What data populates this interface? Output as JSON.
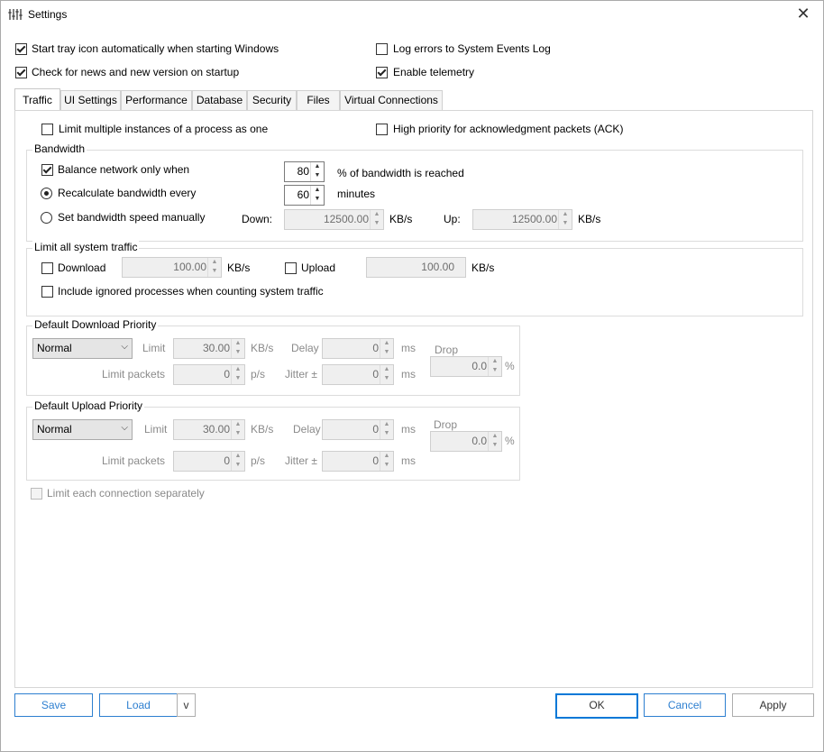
{
  "window": {
    "title": "Settings",
    "app_icon": "settings-app-icon",
    "close_glyph": "✕"
  },
  "global_options": {
    "start_tray": {
      "label": "Start tray icon automatically when starting Windows",
      "checked": true
    },
    "check_news": {
      "label": "Check for news and new version on startup",
      "checked": true
    },
    "log_errors": {
      "label": "Log errors to System Events Log",
      "checked": false
    },
    "telemetry": {
      "label": "Enable telemetry",
      "checked": true
    }
  },
  "tabs": [
    {
      "label": "Traffic",
      "active": true
    },
    {
      "label": "UI Settings",
      "active": false
    },
    {
      "label": "Performance",
      "active": false
    },
    {
      "label": "Database",
      "active": false
    },
    {
      "label": "Security",
      "active": false
    },
    {
      "label": "Files",
      "active": false
    },
    {
      "label": "Virtual Connections",
      "active": false
    }
  ],
  "traffic": {
    "limit_instances": {
      "label": "Limit multiple instances of a process as one",
      "checked": false
    },
    "high_priority_ack": {
      "label": "High priority for acknowledgment packets (ACK)",
      "checked": false
    },
    "bandwidth": {
      "title": "Bandwidth",
      "balance": {
        "label": "Balance network only when",
        "checked": true,
        "value": "80",
        "suffix": "% of bandwidth is reached"
      },
      "recalculate": {
        "label": "Recalculate bandwidth every",
        "selected": true,
        "value": "60",
        "suffix": "minutes"
      },
      "manual": {
        "label": "Set bandwidth speed manually",
        "selected": false
      },
      "down_label": "Down:",
      "down_value": "12500.00",
      "down_unit": "KB/s",
      "up_label": "Up:",
      "up_value": "12500.00",
      "up_unit": "KB/s"
    },
    "system_traffic": {
      "title": "Limit all system traffic",
      "download": {
        "label": "Download",
        "checked": false,
        "value": "100.00",
        "unit": "KB/s"
      },
      "upload": {
        "label": "Upload",
        "checked": false,
        "value": "100.00",
        "unit": "KB/s"
      },
      "include_ignored": {
        "label": "Include ignored processes when counting system traffic",
        "checked": false
      }
    },
    "download_priority": {
      "title": "Default Download Priority",
      "priority": "Normal",
      "limit_label": "Limit",
      "limit_value": "30.00",
      "limit_unit": "KB/s",
      "delay_label": "Delay",
      "delay_value": "0",
      "delay_unit": "ms",
      "packets_label": "Limit packets",
      "packets_value": "0",
      "packets_unit": "p/s",
      "jitter_label": "Jitter ±",
      "jitter_value": "0",
      "jitter_unit": "ms",
      "drop_label": "Drop",
      "drop_value": "0.0",
      "drop_unit": "%"
    },
    "upload_priority": {
      "title": "Default Upload Priority",
      "priority": "Normal",
      "limit_label": "Limit",
      "limit_value": "30.00",
      "limit_unit": "KB/s",
      "delay_label": "Delay",
      "delay_value": "0",
      "delay_unit": "ms",
      "packets_label": "Limit packets",
      "packets_value": "0",
      "packets_unit": "p/s",
      "jitter_label": "Jitter ±",
      "jitter_value": "0",
      "jitter_unit": "ms",
      "drop_label": "Drop",
      "drop_value": "0.0",
      "drop_unit": "%"
    },
    "limit_each_connection": {
      "label": "Limit each connection separately",
      "checked": false,
      "enabled": false
    }
  },
  "footer": {
    "save": "Save",
    "load": "Load",
    "load_menu": "v",
    "ok": "OK",
    "cancel": "Cancel",
    "apply": "Apply"
  },
  "icons": {
    "spin_up": "▲",
    "spin_down": "▼",
    "combo_arrow": "⌵"
  }
}
